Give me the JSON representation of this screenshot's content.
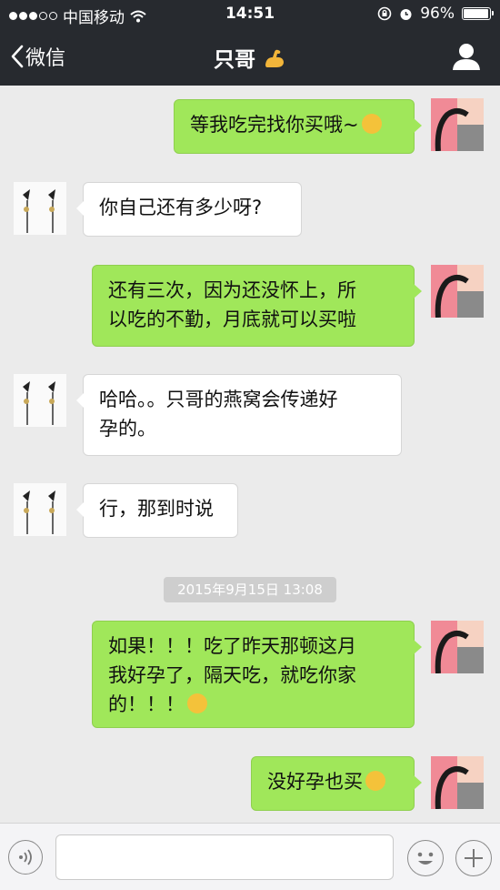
{
  "status_bar": {
    "carrier": "中国移动",
    "time": "14:51",
    "battery_text": "96%",
    "battery_level": 0.96
  },
  "nav": {
    "back_label": "微信",
    "title": "只哥"
  },
  "messages": [
    {
      "side": "out",
      "text": "等我吃完找你买哦~",
      "emoji": "grinning-emoji"
    },
    {
      "side": "in",
      "text": "你自己还有多少呀?"
    },
    {
      "side": "out",
      "lines": [
        "还有三次，因为还没怀上，所",
        "以吃的不勤，月底就可以买啦"
      ]
    },
    {
      "side": "in",
      "lines": [
        "哈哈。。只哥的燕窝会传递好",
        "孕的。"
      ]
    },
    {
      "side": "in",
      "text": "行，那到时说"
    },
    {
      "side": "out",
      "lines": [
        "如果！！！吃了昨天那顿这月",
        "我好孕了，隔天吃，就吃你家",
        "的！！！"
      ],
      "emoji": "yawn-emoji"
    },
    {
      "side": "out",
      "text": "没好孕也买",
      "emoji": "yawn-emoji"
    }
  ],
  "timestamp": "2015年9月15日 13:08",
  "input_bar": {
    "placeholder": ""
  },
  "colors": {
    "header_bg": "#272a2f",
    "chat_bg": "#ebebeb",
    "out_bubble": "#a0e75a",
    "in_bubble": "#ffffff"
  }
}
